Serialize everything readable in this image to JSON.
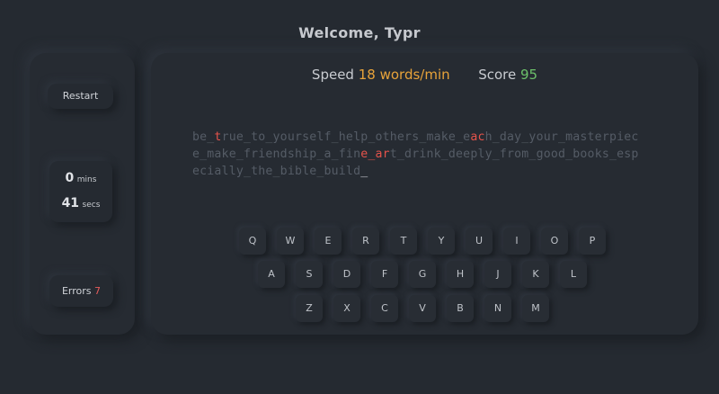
{
  "header": {
    "title": "Welcome, Typr"
  },
  "sidebar": {
    "restart_label": "Restart",
    "timer": {
      "mins_value": "0",
      "mins_unit": "mins",
      "secs_value": "41",
      "secs_unit": "secs"
    },
    "errors": {
      "label": "Errors",
      "count": "7"
    }
  },
  "stats": {
    "speed_label": "Speed",
    "speed_value": "18 words/min",
    "score_label": "Score",
    "score_value": "95"
  },
  "typing": {
    "lines": [
      [
        {
          "t": "be_",
          "s": "normal"
        },
        {
          "t": "t",
          "s": "error"
        },
        {
          "t": "rue_to_yourself_help_others_make_e",
          "s": "normal"
        },
        {
          "t": "ac",
          "s": "error"
        },
        {
          "t": "h_day_your_masterpiec",
          "s": "normal"
        }
      ],
      [
        {
          "t": "e_make_friendship_a_fin",
          "s": "normal"
        },
        {
          "t": "e_ar",
          "s": "error"
        },
        {
          "t": "t_drink_deeply_from_good_books_esp",
          "s": "normal"
        }
      ],
      [
        {
          "t": "ecially_the_bible_build",
          "s": "normal"
        },
        {
          "t": "_",
          "s": "cursor"
        }
      ]
    ]
  },
  "keyboard": {
    "rows": [
      [
        "Q",
        "W",
        "E",
        "R",
        "T",
        "Y",
        "U",
        "I",
        "O",
        "P"
      ],
      [
        "A",
        "S",
        "D",
        "F",
        "G",
        "H",
        "J",
        "K",
        "L"
      ],
      [
        "Z",
        "X",
        "C",
        "V",
        "B",
        "N",
        "M"
      ]
    ]
  }
}
